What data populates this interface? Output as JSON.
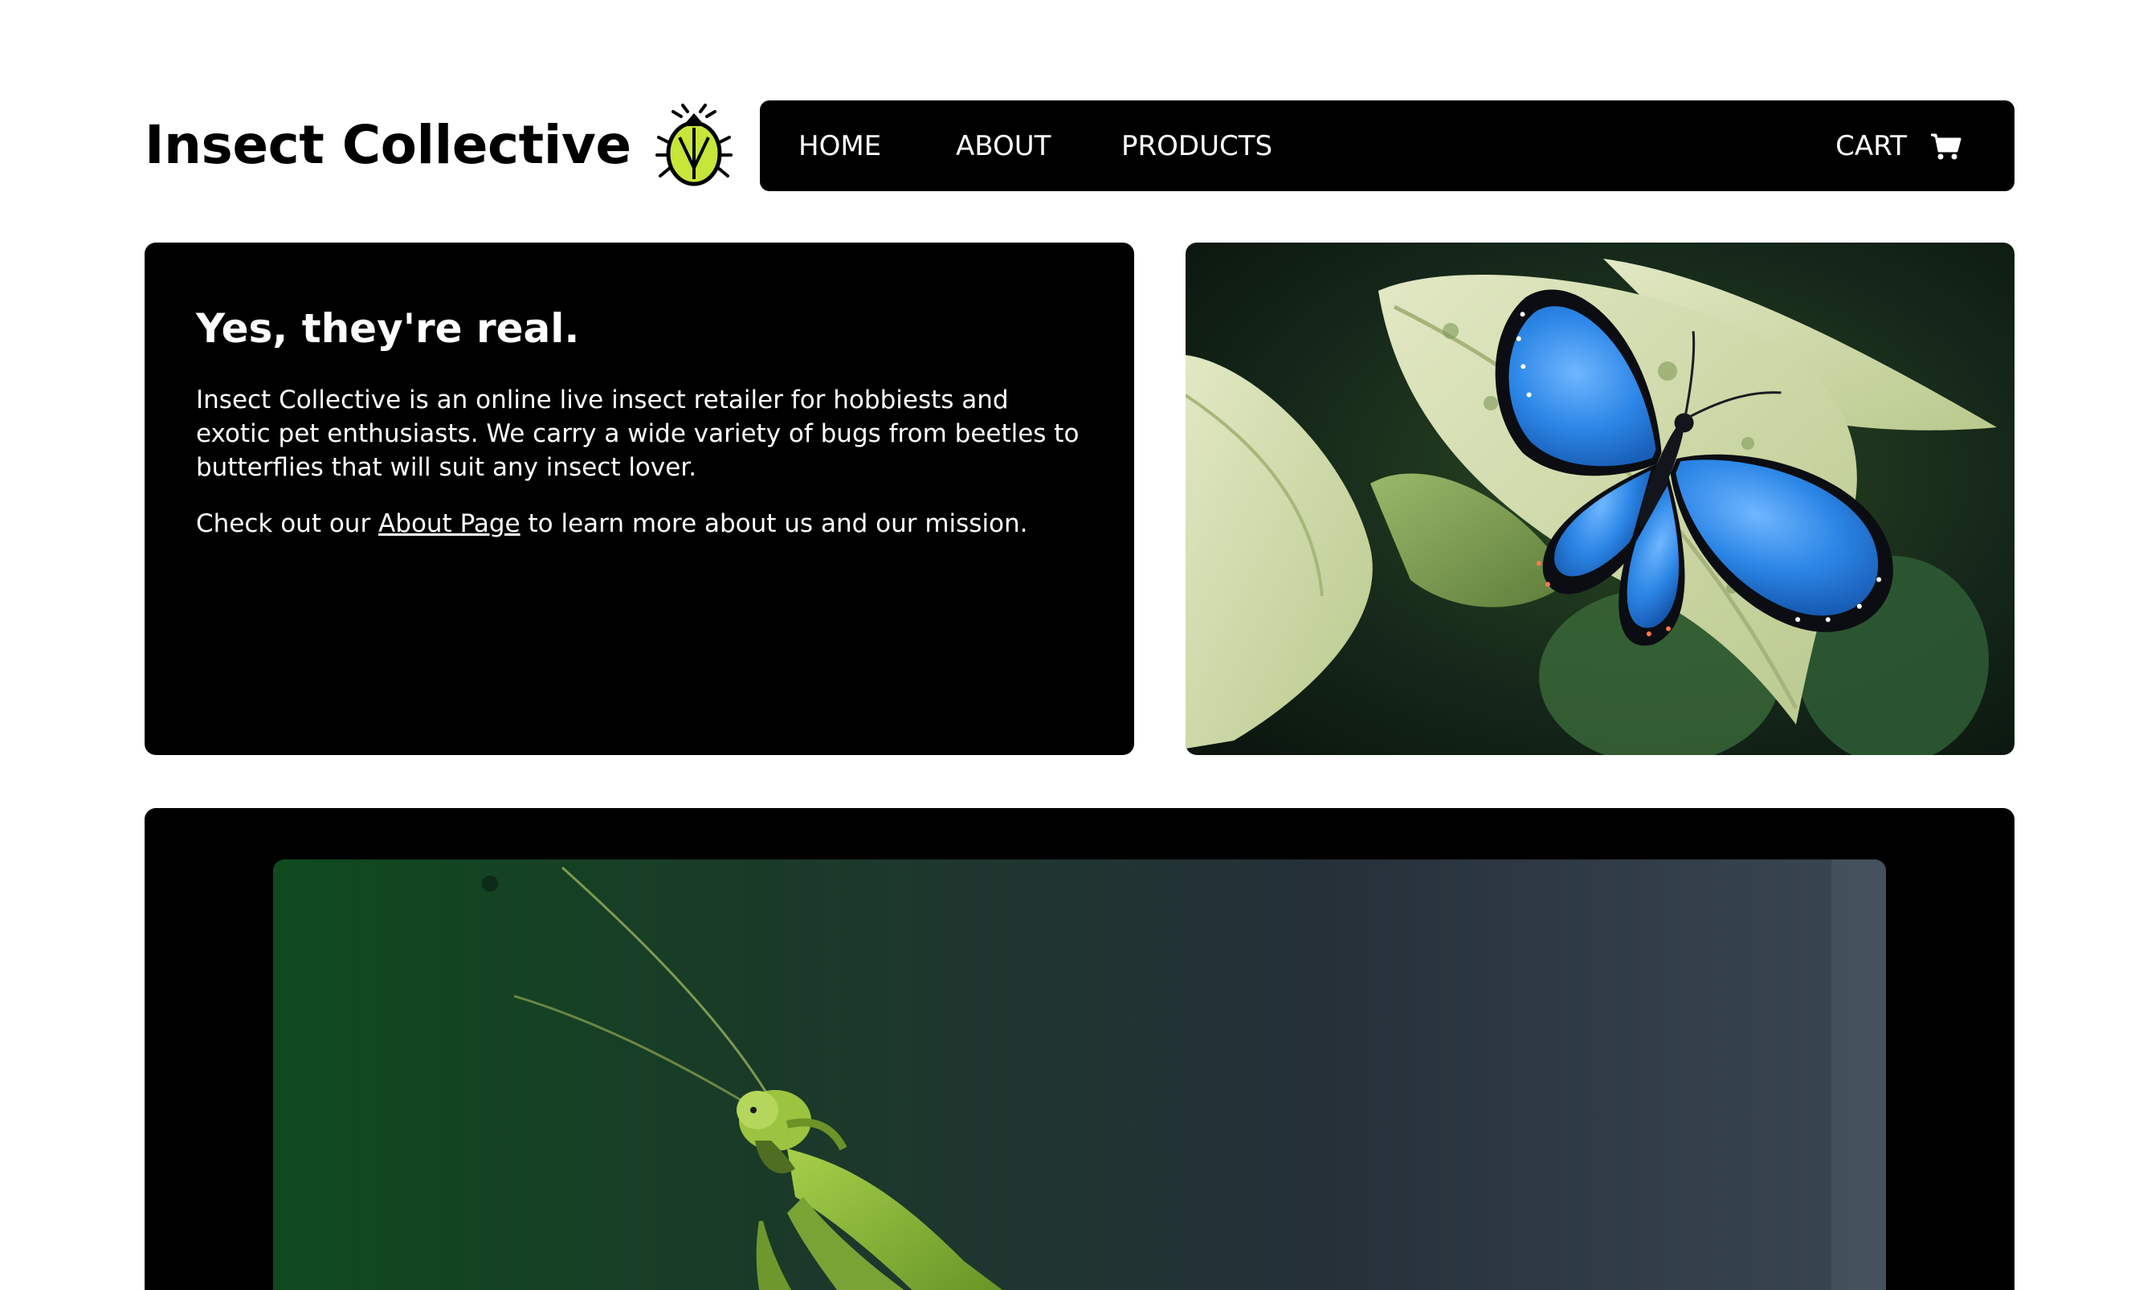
{
  "brand": {
    "title": "Insect Collective",
    "logo_icon": "beetle-icon",
    "logo_accent": "#c6e63a"
  },
  "nav": {
    "home": "HOME",
    "about": "ABOUT",
    "products": "PRODUCTS",
    "cart": "CART",
    "cart_icon": "shopping-cart-icon"
  },
  "intro": {
    "heading": "Yes, they're real.",
    "paragraph": "Insect Collective is an online live insect retailer for hobbiests and exotic pet enthusiasts. We carry a wide variety of bugs from beetles to butterflies that will suit any insect lover.",
    "cta_prefix": "Check out our ",
    "cta_link": "About Page",
    "cta_suffix": " to learn more about us and our mission."
  },
  "images": {
    "hero": "blue-morpho-butterfly-photo",
    "feature": "praying-mantis-photo"
  },
  "colors": {
    "panel": "#000000",
    "background": "#ffffff",
    "butterfly_blue": "#2f86e0",
    "leaf_green": "#cfdcaa"
  }
}
